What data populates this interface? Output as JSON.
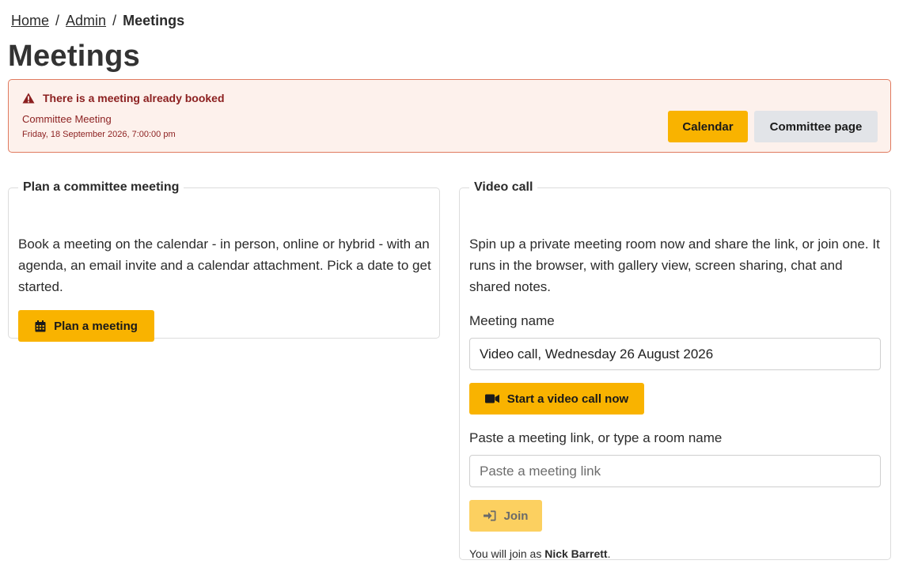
{
  "breadcrumb": {
    "home": "Home",
    "admin": "Admin",
    "separator": "/",
    "current": "Meetings"
  },
  "page_title": "Meetings",
  "alert": {
    "heading": "There is a meeting already booked",
    "meeting_title": "Committee Meeting",
    "meeting_datetime": "Friday, 18 September 2026, 7:00:00 pm",
    "calendar_label": "Calendar",
    "committee_page_label": "Committee page",
    "icon": "warning-triangle-icon"
  },
  "plan_panel": {
    "legend": "Plan a committee meeting",
    "description": "Book a meeting on the calendar - in person, online or hybrid - with an agenda, an email invite and a calendar attachment. Pick a date to get started.",
    "button_label": "Plan a meeting",
    "button_icon": "calendar-icon"
  },
  "video_panel": {
    "legend": "Video call",
    "description": "Spin up a private meeting room now and share the link, or join one. It runs in the browser, with gallery view, screen sharing, chat and shared notes.",
    "name_label": "Meeting name",
    "name_value": "Video call, Wednesday 26 August 2026",
    "start_label": "Start a video call now",
    "start_icon": "video-camera-icon",
    "link_label": "Paste a meeting link, or type a room name",
    "link_placeholder": "Paste a meeting link",
    "join_label": "Join",
    "join_icon": "sign-in-icon",
    "join_as_prefix": "You will join as",
    "join_as_name": "Nick Barrett",
    "join_as_suffix": "."
  },
  "colors": {
    "accent": "#f9b300",
    "alert_bg": "#fdf1ec",
    "alert_border": "#e07a5f",
    "alert_text": "#8b1f1f"
  }
}
